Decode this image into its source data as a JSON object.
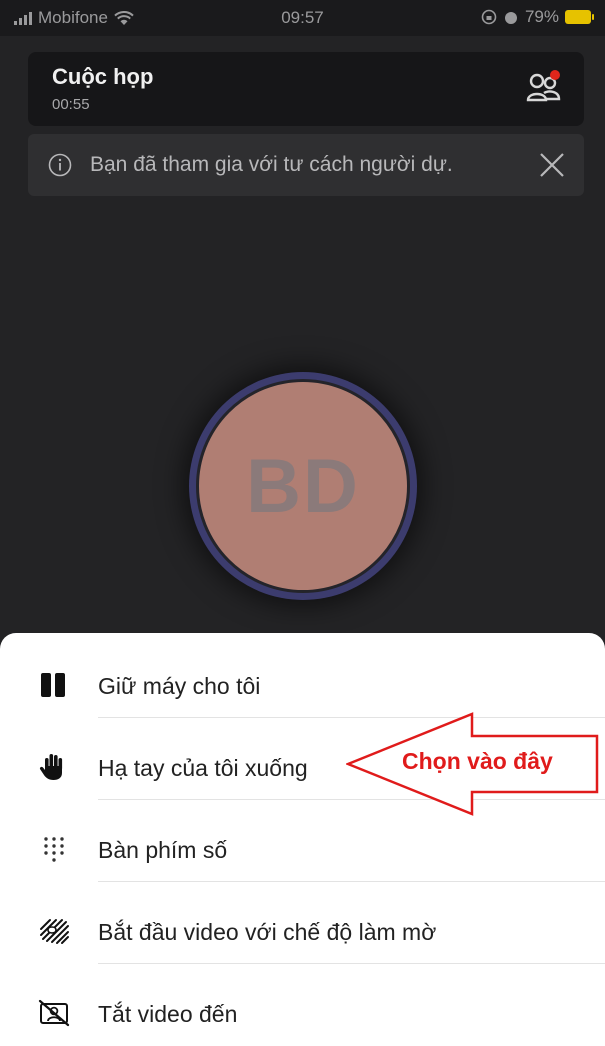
{
  "status_bar": {
    "carrier": "Mobifone",
    "time": "09:57",
    "battery": "79%",
    "icons": [
      "signal-icon",
      "wifi-icon",
      "rotation-lock-icon",
      "alarm-icon",
      "battery-charging-icon"
    ]
  },
  "header": {
    "title": "Cuộc họp",
    "elapsed": "00:55",
    "participants_icon": "people-icon",
    "notification_dot_color": "#e0261b"
  },
  "banner": {
    "icon": "info-icon",
    "text": "Bạn đã tham gia với tư cách người dự.",
    "close_icon": "close-icon"
  },
  "avatar": {
    "initials": "BD",
    "fill_color": "#b07e73",
    "ring_color": "#3c3c6e"
  },
  "menu": {
    "items": [
      {
        "label": "Giữ máy cho tôi",
        "icon": "pause-icon"
      },
      {
        "label": "Hạ tay của tôi xuống",
        "icon": "raised-hand-icon"
      },
      {
        "label": "Bàn phím số",
        "icon": "dialpad-icon"
      },
      {
        "label": "Bắt đầu video với chế độ làm mờ",
        "icon": "blur-background-icon"
      },
      {
        "label": "Tắt video đến",
        "icon": "video-off-icon"
      }
    ]
  },
  "annotation": {
    "text": "Chọn vào đây",
    "color": "#e01b1b"
  }
}
